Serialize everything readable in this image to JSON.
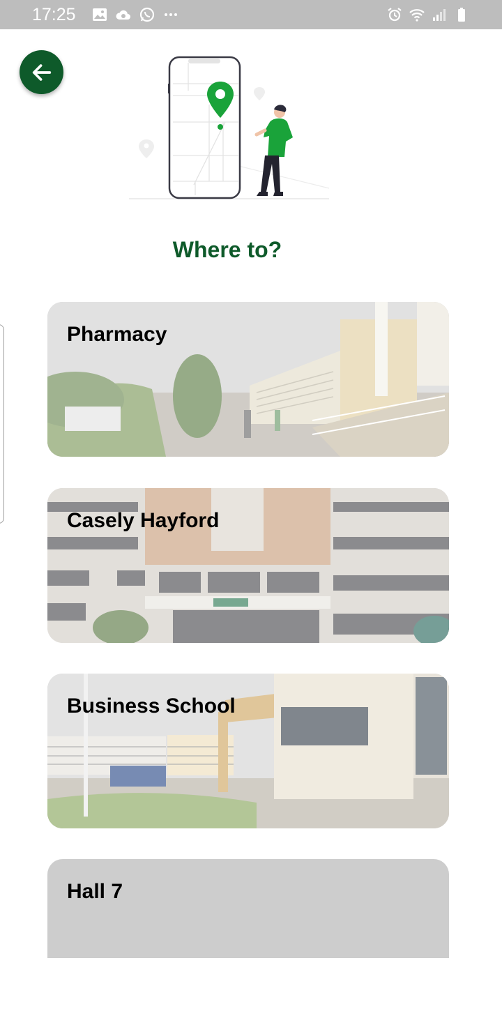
{
  "status_bar": {
    "time": "17:25",
    "left_icons": [
      "gallery-icon",
      "cloud-sync-icon",
      "whatsapp-icon",
      "more-icon"
    ],
    "right_icons": [
      "alarm-icon",
      "wifi-icon",
      "signal-icon",
      "battery-icon"
    ]
  },
  "header": {
    "back_icon": "arrow-left-icon",
    "illustration": "phone-map-pin-person"
  },
  "page": {
    "title": "Where to?"
  },
  "destinations": [
    {
      "label": "Pharmacy",
      "image": "campus-courtyard-photo"
    },
    {
      "label": "Casely Hayford",
      "image": "building-facade-photo"
    },
    {
      "label": "Business School",
      "image": "business-school-photo"
    },
    {
      "label": "Hall 7",
      "image": "none"
    }
  ],
  "colors": {
    "primary": "#0e5a2a",
    "pin_green": "#1aa33a",
    "status_bar": "#bdbdbd"
  }
}
